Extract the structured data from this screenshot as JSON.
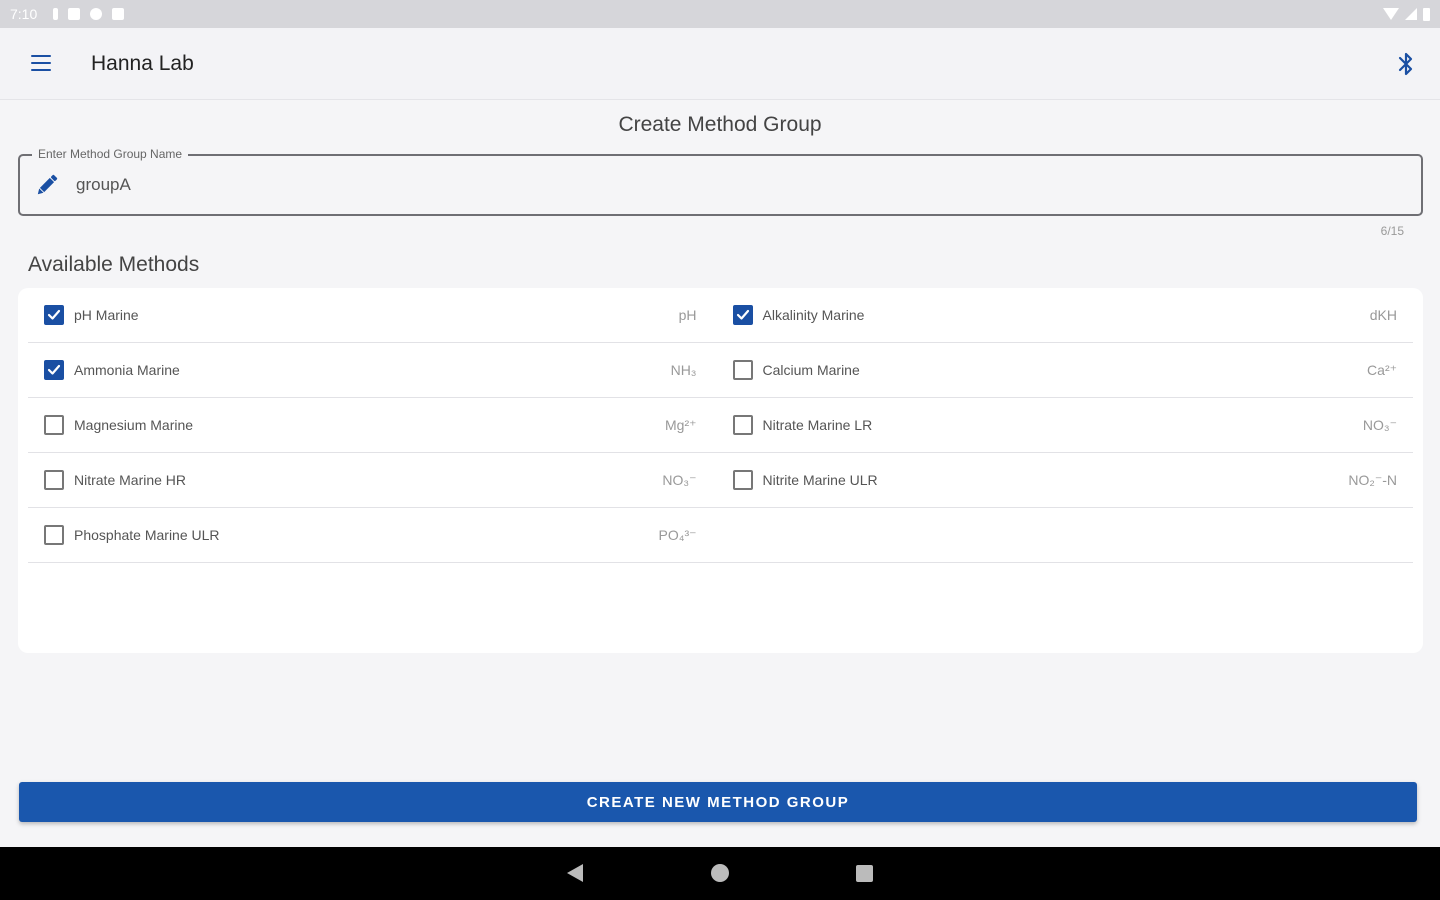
{
  "status_bar": {
    "time": "7:10"
  },
  "app_bar": {
    "title": "Hanna Lab"
  },
  "page": {
    "title": "Create Method Group"
  },
  "name_field": {
    "label": "Enter Method Group Name",
    "value": "groupA",
    "counter": "6/15"
  },
  "methods_section": {
    "heading": "Available Methods",
    "methods": [
      {
        "name": "pH Marine",
        "unit": "pH",
        "checked": true
      },
      {
        "name": "Alkalinity Marine",
        "unit": "dKH",
        "checked": true
      },
      {
        "name": "Ammonia Marine",
        "unit": "NH₃",
        "checked": true
      },
      {
        "name": "Calcium Marine",
        "unit": "Ca²⁺",
        "checked": false
      },
      {
        "name": "Magnesium Marine",
        "unit": "Mg²⁺",
        "checked": false
      },
      {
        "name": "Nitrate Marine LR",
        "unit": "NO₃⁻",
        "checked": false
      },
      {
        "name": "Nitrate Marine HR",
        "unit": "NO₃⁻",
        "checked": false
      },
      {
        "name": "Nitrite Marine ULR",
        "unit": "NO₂⁻-N",
        "checked": false
      },
      {
        "name": "Phosphate Marine ULR",
        "unit": "PO₄³⁻",
        "checked": false
      }
    ]
  },
  "actions": {
    "create_label": "CREATE NEW METHOD GROUP"
  },
  "colors": {
    "accent": "#1a4fa3",
    "button": "#1a57ad"
  }
}
